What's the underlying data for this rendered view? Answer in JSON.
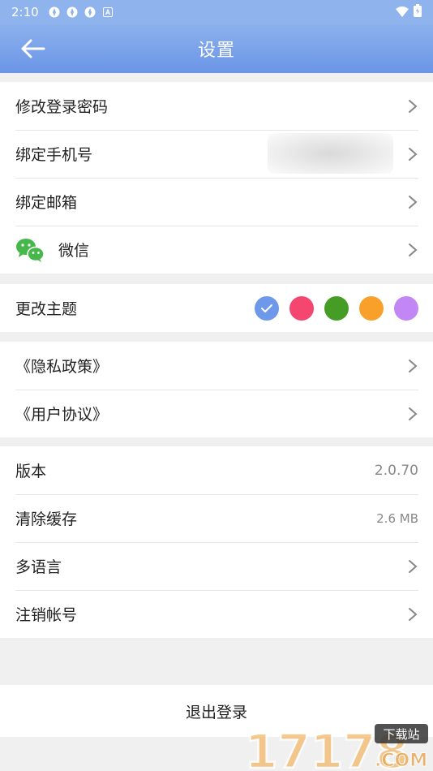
{
  "status_bar": {
    "time": "2:10"
  },
  "header": {
    "title": "设置"
  },
  "account": [
    {
      "label": "修改登录密码"
    },
    {
      "label": "绑定手机号"
    },
    {
      "label": "绑定邮箱"
    },
    {
      "label": "微信"
    }
  ],
  "theme": {
    "label": "更改主题",
    "colors": [
      "#6e99ea",
      "#f4466f",
      "#459d25",
      "#f9a02b",
      "#c286f5"
    ],
    "selected_index": 0
  },
  "legal": [
    {
      "label": "《隐私政策》"
    },
    {
      "label": "《用户协议》"
    }
  ],
  "app": {
    "version_label": "版本",
    "version_value": "2.0.70",
    "cache_label": "清除缓存",
    "cache_value": "2.6 MB",
    "language_label": "多语言",
    "delete_account_label": "注销帐号"
  },
  "logout_label": "退出登录",
  "watermark": {
    "number": "17178",
    "badge": "下载站",
    "domain": ".COM"
  }
}
